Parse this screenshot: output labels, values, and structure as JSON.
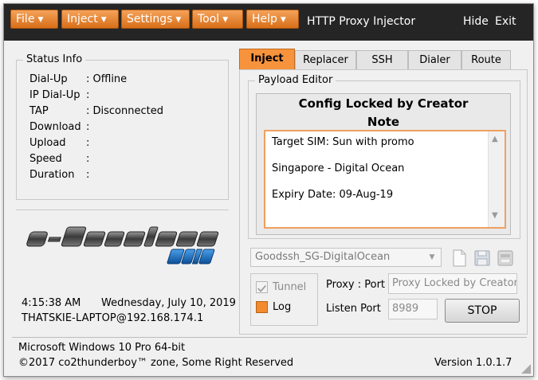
{
  "window": {
    "title": "HTTP Proxy Injector",
    "hide_label": "Hide",
    "exit_label": "Exit"
  },
  "menu": {
    "items": [
      {
        "label": "File"
      },
      {
        "label": "Inject"
      },
      {
        "label": "Settings"
      },
      {
        "label": "Tool"
      },
      {
        "label": "Help"
      }
    ]
  },
  "status": {
    "title": "Status Info",
    "rows": [
      {
        "label": "Dial-Up",
        "value": ": Offline"
      },
      {
        "label": "IP Dial-Up",
        "value": ":"
      },
      {
        "label": "TAP",
        "value": ": Disconnected"
      },
      {
        "label": "Download",
        "value": ":"
      },
      {
        "label": "Upload",
        "value": ":"
      },
      {
        "label": "Speed",
        "value": ":"
      },
      {
        "label": "Duration",
        "value": ":"
      }
    ]
  },
  "clock": {
    "time": "4:15:38 AM",
    "date": "Wednesday, July 10, 2019",
    "host": "THATSKIE-LAPTOP@192.168.174.1"
  },
  "tabs": [
    {
      "label": "Inject",
      "active": true
    },
    {
      "label": "Replacer"
    },
    {
      "label": "SSH"
    },
    {
      "label": "Dialer"
    },
    {
      "label": "Route"
    }
  ],
  "payload": {
    "group_label": "Payload Editor",
    "locked_title": "Config Locked by Creator",
    "note_title": "Note",
    "note_lines": [
      "Target SIM: Sun with promo",
      "Singapore - Digital Ocean",
      "Expiry Date: 09-Aug-19"
    ]
  },
  "config_select": {
    "value": "Goodssh_SG-DigitalOcean"
  },
  "controls": {
    "tunnel_label": "Tunnel",
    "log_label": "Log",
    "proxy_port_label": "Proxy : Port",
    "proxy_value": "Proxy Locked by Creator",
    "listen_port_label": "Listen Port",
    "listen_port_value": "8989",
    "stop_label": "STOP"
  },
  "footer": {
    "os": "Microsoft Windows 10 Pro 64-bit",
    "copyright": "©2017 co2thunderboy™ zone, Some Right Reserved",
    "version": "Version 1.0.1.7"
  },
  "colors": {
    "accent": "#f6933c",
    "titlebar": "#252525"
  }
}
